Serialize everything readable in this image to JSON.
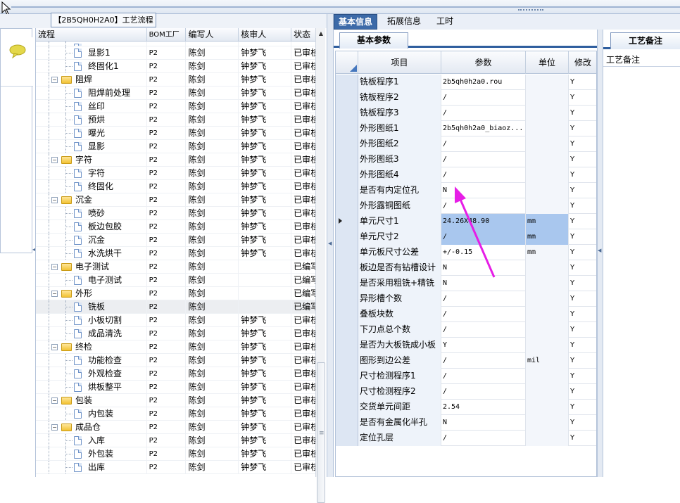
{
  "process_tab": "【2B5QH0H2A0】工艺流程",
  "tree_columns": [
    "流程",
    "BOM工厂",
    "编写人",
    "核审人",
    "状态"
  ],
  "tree_rows": [
    {
      "label": "",
      "level": 2,
      "kind": "doc",
      "bom": "",
      "writer": "",
      "reviewer": "",
      "status": "",
      "partial": true
    },
    {
      "label": "显影1",
      "level": 2,
      "kind": "doc",
      "bom": "P2",
      "writer": "陈剑",
      "reviewer": "钟梦飞",
      "status": "已审核"
    },
    {
      "label": "终固化1",
      "level": 2,
      "kind": "doc",
      "bom": "P2",
      "writer": "陈剑",
      "reviewer": "钟梦飞",
      "status": "已审核"
    },
    {
      "label": "阻焊",
      "level": 1,
      "kind": "folder",
      "bom": "P2",
      "writer": "陈剑",
      "reviewer": "钟梦飞",
      "status": "已审核"
    },
    {
      "label": "阻焊前处理",
      "level": 2,
      "kind": "doc",
      "bom": "P2",
      "writer": "陈剑",
      "reviewer": "钟梦飞",
      "status": "已审核"
    },
    {
      "label": "丝印",
      "level": 2,
      "kind": "doc",
      "bom": "P2",
      "writer": "陈剑",
      "reviewer": "钟梦飞",
      "status": "已审核"
    },
    {
      "label": "预烘",
      "level": 2,
      "kind": "doc",
      "bom": "P2",
      "writer": "陈剑",
      "reviewer": "钟梦飞",
      "status": "已审核"
    },
    {
      "label": "曝光",
      "level": 2,
      "kind": "doc",
      "bom": "P2",
      "writer": "陈剑",
      "reviewer": "钟梦飞",
      "status": "已审核"
    },
    {
      "label": "显影",
      "level": 2,
      "kind": "doc",
      "bom": "P2",
      "writer": "陈剑",
      "reviewer": "钟梦飞",
      "status": "已审核"
    },
    {
      "label": "字符",
      "level": 1,
      "kind": "folder",
      "bom": "P2",
      "writer": "陈剑",
      "reviewer": "钟梦飞",
      "status": "已审核"
    },
    {
      "label": "字符",
      "level": 2,
      "kind": "doc",
      "bom": "P2",
      "writer": "陈剑",
      "reviewer": "钟梦飞",
      "status": "已审核"
    },
    {
      "label": "终固化",
      "level": 2,
      "kind": "doc",
      "bom": "P2",
      "writer": "陈剑",
      "reviewer": "钟梦飞",
      "status": "已审核"
    },
    {
      "label": "沉金",
      "level": 1,
      "kind": "folder",
      "bom": "P2",
      "writer": "陈剑",
      "reviewer": "钟梦飞",
      "status": "已审核"
    },
    {
      "label": "喷砂",
      "level": 2,
      "kind": "doc",
      "bom": "P2",
      "writer": "陈剑",
      "reviewer": "钟梦飞",
      "status": "已审核"
    },
    {
      "label": "板边包胶",
      "level": 2,
      "kind": "doc",
      "bom": "P2",
      "writer": "陈剑",
      "reviewer": "钟梦飞",
      "status": "已审核"
    },
    {
      "label": "沉金",
      "level": 2,
      "kind": "doc",
      "bom": "P2",
      "writer": "陈剑",
      "reviewer": "钟梦飞",
      "status": "已审核"
    },
    {
      "label": "水洗烘干",
      "level": 2,
      "kind": "doc",
      "bom": "P2",
      "writer": "陈剑",
      "reviewer": "钟梦飞",
      "status": "已审核"
    },
    {
      "label": "电子测试",
      "level": 1,
      "kind": "folder",
      "bom": "P2",
      "writer": "陈剑",
      "reviewer": "",
      "status": "已编写"
    },
    {
      "label": "电子测试",
      "level": 2,
      "kind": "doc",
      "bom": "P2",
      "writer": "陈剑",
      "reviewer": "",
      "status": "已编写"
    },
    {
      "label": "外形",
      "level": 1,
      "kind": "folder",
      "bom": "P2",
      "writer": "陈剑",
      "reviewer": "",
      "status": "已编写"
    },
    {
      "label": "铣板",
      "level": 2,
      "kind": "doc",
      "bom": "P2",
      "writer": "陈剑",
      "reviewer": "",
      "status": "已编写",
      "selected": true
    },
    {
      "label": "小板切割",
      "level": 2,
      "kind": "doc",
      "bom": "P2",
      "writer": "陈剑",
      "reviewer": "钟梦飞",
      "status": "已审核"
    },
    {
      "label": "成品清洗",
      "level": 2,
      "kind": "doc",
      "bom": "P2",
      "writer": "陈剑",
      "reviewer": "钟梦飞",
      "status": "已审核"
    },
    {
      "label": "终检",
      "level": 1,
      "kind": "folder",
      "bom": "P2",
      "writer": "陈剑",
      "reviewer": "钟梦飞",
      "status": "已审核"
    },
    {
      "label": "功能检查",
      "level": 2,
      "kind": "doc",
      "bom": "P2",
      "writer": "陈剑",
      "reviewer": "钟梦飞",
      "status": "已审核"
    },
    {
      "label": "外观检查",
      "level": 2,
      "kind": "doc",
      "bom": "P2",
      "writer": "陈剑",
      "reviewer": "钟梦飞",
      "status": "已审核"
    },
    {
      "label": "烘板整平",
      "level": 2,
      "kind": "doc",
      "bom": "P2",
      "writer": "陈剑",
      "reviewer": "钟梦飞",
      "status": "已审核"
    },
    {
      "label": "包装",
      "level": 1,
      "kind": "folder",
      "bom": "P2",
      "writer": "陈剑",
      "reviewer": "钟梦飞",
      "status": "已审核"
    },
    {
      "label": "内包装",
      "level": 2,
      "kind": "doc",
      "bom": "P2",
      "writer": "陈剑",
      "reviewer": "钟梦飞",
      "status": "已审核"
    },
    {
      "label": "成品仓",
      "level": 1,
      "kind": "folder",
      "bom": "P2",
      "writer": "陈剑",
      "reviewer": "钟梦飞",
      "status": "已审核"
    },
    {
      "label": "入库",
      "level": 2,
      "kind": "doc",
      "bom": "P2",
      "writer": "陈剑",
      "reviewer": "钟梦飞",
      "status": "已审核"
    },
    {
      "label": "外包装",
      "level": 2,
      "kind": "doc",
      "bom": "P2",
      "writer": "陈剑",
      "reviewer": "钟梦飞",
      "status": "已审核"
    },
    {
      "label": "出库",
      "level": 2,
      "kind": "doc",
      "bom": "P2",
      "writer": "陈剑",
      "reviewer": "钟梦飞",
      "status": "已审核"
    }
  ],
  "right_tabs": [
    "基本信息",
    "拓展信息",
    "工时"
  ],
  "sub_tab": "基本参数",
  "grid_columns": [
    "项目",
    "参数",
    "单位",
    "修改"
  ],
  "grid_rows": [
    {
      "item": "铣板程序1",
      "value": "2b5qh0h2a0.rou",
      "unit": "",
      "mod": "Y"
    },
    {
      "item": "铣板程序2",
      "value": "/",
      "unit": "",
      "mod": "Y"
    },
    {
      "item": "铣板程序3",
      "value": "/",
      "unit": "",
      "mod": "Y"
    },
    {
      "item": "外形图纸1",
      "value": "2b5qh0h2a0_biaoz...",
      "unit": "",
      "mod": "Y"
    },
    {
      "item": "外形图纸2",
      "value": "/",
      "unit": "",
      "mod": "Y"
    },
    {
      "item": "外形图纸3",
      "value": "/",
      "unit": "",
      "mod": "Y"
    },
    {
      "item": "外形图纸4",
      "value": "/",
      "unit": "",
      "mod": "Y"
    },
    {
      "item": "是否有内定位孔",
      "value": "N",
      "unit": "",
      "mod": "Y"
    },
    {
      "item": "外形露铜图纸",
      "value": "/",
      "unit": "",
      "mod": "Y"
    },
    {
      "item": "单元尺寸1",
      "value": "24.26X48.90",
      "unit": "mm",
      "mod": "Y",
      "highlight": true,
      "current": true
    },
    {
      "item": "单元尺寸2",
      "value": "/",
      "unit": "mm",
      "mod": "Y",
      "highlight": true
    },
    {
      "item": "单元板尺寸公差",
      "value": "+/-0.15",
      "unit": "mm",
      "mod": "Y"
    },
    {
      "item": "板边是否有钻槽设计",
      "value": "N",
      "unit": "",
      "mod": "Y"
    },
    {
      "item": "是否采用粗铣+精铣",
      "value": "N",
      "unit": "",
      "mod": "Y"
    },
    {
      "item": "异形槽个数",
      "value": "/",
      "unit": "",
      "mod": "Y"
    },
    {
      "item": "叠板块数",
      "value": "/",
      "unit": "",
      "mod": "Y"
    },
    {
      "item": "下刀点总个数",
      "value": "/",
      "unit": "",
      "mod": "Y"
    },
    {
      "item": "是否为大板铣成小板",
      "value": "Y",
      "unit": "",
      "mod": "Y"
    },
    {
      "item": "图形到边公差",
      "value": "/",
      "unit": "mil",
      "mod": "Y"
    },
    {
      "item": "尺寸检测程序1",
      "value": "/",
      "unit": "",
      "mod": "Y"
    },
    {
      "item": "尺寸检测程序2",
      "value": "/",
      "unit": "",
      "mod": "Y"
    },
    {
      "item": "交货单元间距",
      "value": "2.54",
      "unit": "",
      "mod": "Y"
    },
    {
      "item": "是否有金属化半孔",
      "value": "N",
      "unit": "",
      "mod": "Y"
    },
    {
      "item": "定位孔层",
      "value": "/",
      "unit": "",
      "mod": "Y"
    }
  ],
  "notes_tab": "工艺备注",
  "notes_label": "工艺备注",
  "colors": {
    "accent": "#3c6aa8",
    "highlight": "#a9c7ee",
    "annotation_arrow": "#e61ee6"
  }
}
